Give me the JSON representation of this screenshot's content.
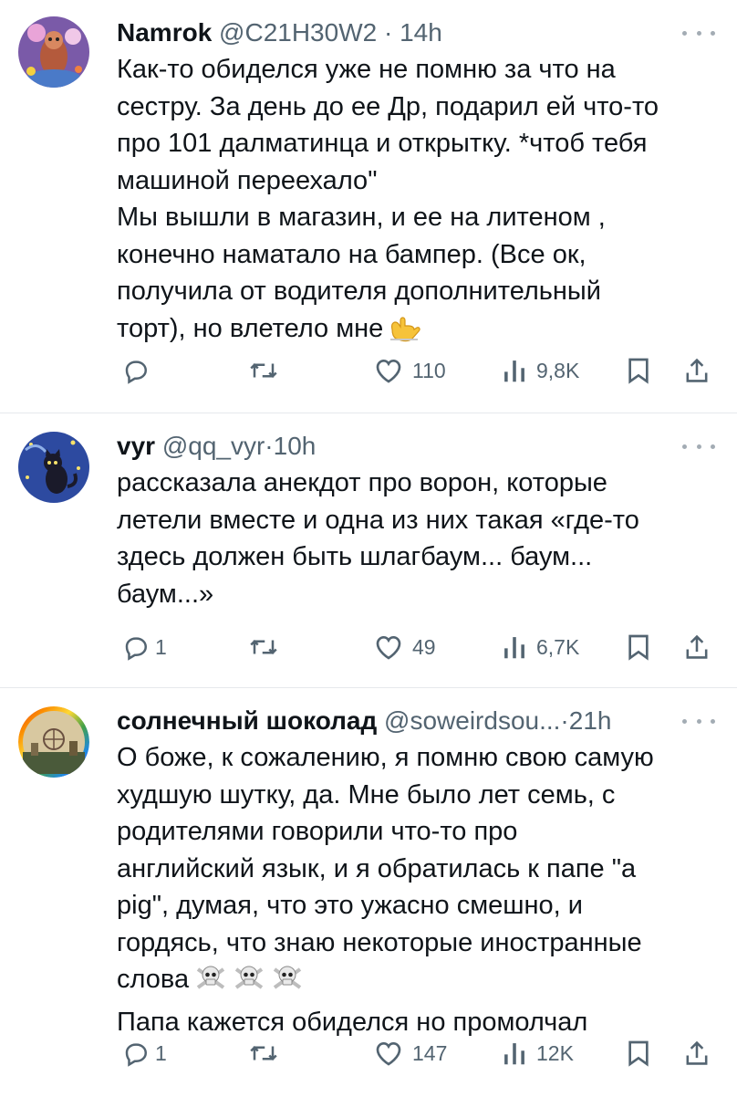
{
  "tweets": [
    {
      "name": "Namrok",
      "handle": "@C21H30W2",
      "separator": "·",
      "time": "14h",
      "text": "Как-то обиделся уже не помню за что на\nсестру. За день до ее Др, подарил ей что-то\nпро 101 далматинца и открытку. *чтоб тебя\nмашиной переехало\"\nМы вышли в магазин, и ее на литеном ,\nконечно наматало на бампер. (Все ок,\nполучила от водителя дополнительный\nторт), но влетело мне",
      "emoji": "call-me-hand-emoji",
      "replies": "",
      "retweets": "",
      "likes": "110",
      "views": "9,8K"
    },
    {
      "name": "vyr",
      "handle": "@qq_vyr",
      "separator": "·",
      "time": "10h",
      "text": "рассказала анекдот про ворон, которые\nлетели вместе и одна из них такая «где-то\nздесь должен быть шлагбаум... баум...\nбаум...»",
      "replies": "1",
      "retweets": "",
      "likes": "49",
      "views": "6,7K"
    },
    {
      "name": "солнечный шоколад",
      "handle": "@soweirdsou...",
      "separator": "·",
      "time": "21h",
      "text_main": "О боже, к сожалению, я помню свою самую\nхудшую шутку, да. Мне было лет семь, с\nродителями говорили что-то про\nанглийский язык, и я обратилась к папе \"а\npig\", думая, что это ужасно смешно, и\nгордясь, что знаю некоторые иностранные\nслова",
      "emoji": "skull-and-crossbones-emoji",
      "text_end": "Папа кажется обиделся но промолчал",
      "replies": "1",
      "retweets": "",
      "likes": "147",
      "views": "12K"
    }
  ],
  "icons": {
    "reply": "reply-icon",
    "retweet": "retweet-icon",
    "like": "heart-icon",
    "views": "views-icon",
    "bookmark": "bookmark-icon",
    "share": "share-icon",
    "more": "more-icon"
  },
  "colors": {
    "text": "#0f1419",
    "muted": "#536471",
    "divider": "#e6e9ec"
  }
}
